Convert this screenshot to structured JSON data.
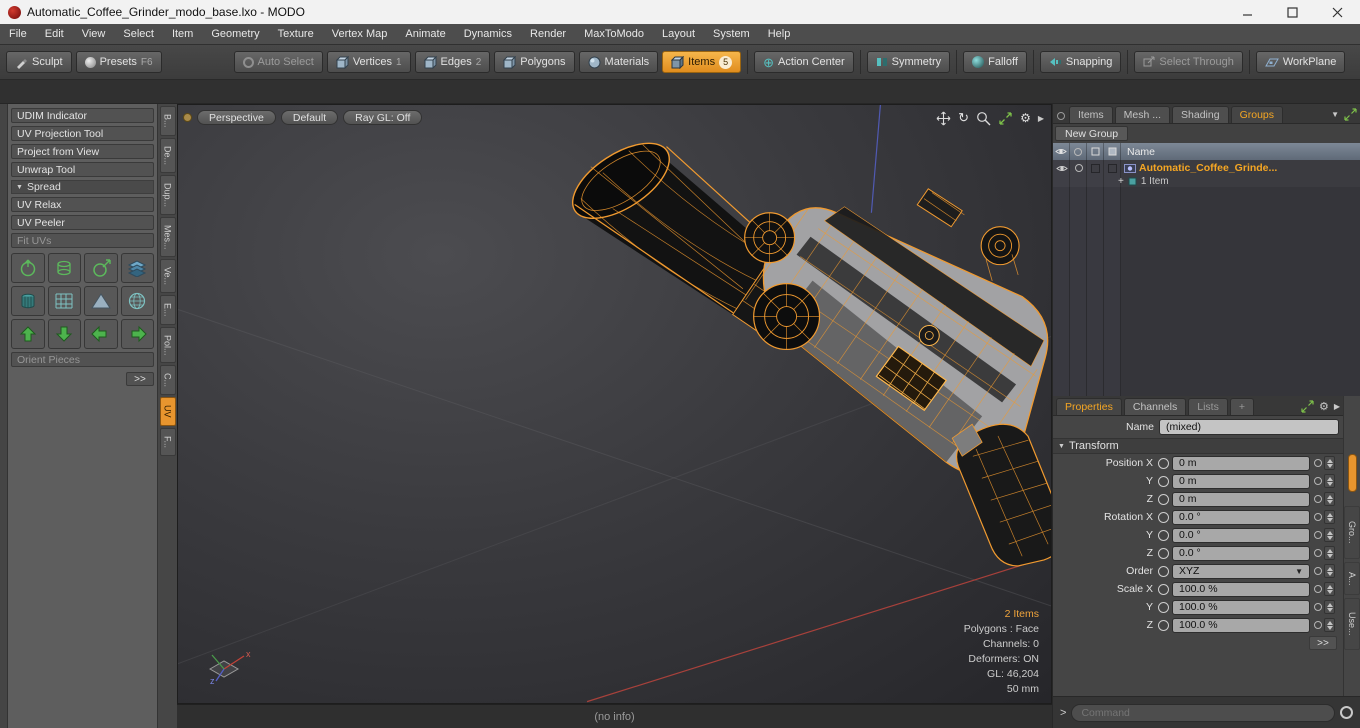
{
  "window": {
    "title": "Automatic_Coffee_Grinder_modo_base.lxo - MODO"
  },
  "menu": {
    "items": [
      "File",
      "Edit",
      "View",
      "Select",
      "Item",
      "Geometry",
      "Texture",
      "Vertex Map",
      "Animate",
      "Dynamics",
      "Render",
      "MaxToModo",
      "Layout",
      "System",
      "Help"
    ]
  },
  "toolbar": {
    "sculpt": "Sculpt",
    "presets": "Presets",
    "presets_key": "F6",
    "auto_select": "Auto Select",
    "vertices": "Vertices",
    "vertices_key": "1",
    "edges": "Edges",
    "edges_key": "2",
    "polygons": "Polygons",
    "materials": "Materials",
    "items": "Items",
    "items_badge": "5",
    "action_center": "Action Center",
    "symmetry": "Symmetry",
    "falloff": "Falloff",
    "snapping": "Snapping",
    "select_through": "Select Through",
    "workplane": "WorkPlane"
  },
  "left_panel": {
    "tools": [
      "UDIM Indicator",
      "UV Projection Tool",
      "Project from View",
      "Unwrap Tool"
    ],
    "spread_header": "Spread",
    "uv_relax": "UV Relax",
    "uv_peeler": "UV Peeler",
    "fit_uvs": "Fit UVs",
    "orient_pieces": "Orient Pieces",
    "more": ">>",
    "tabs": [
      "B...",
      "De...",
      "Dup...",
      "Mes...",
      "Ve...",
      "E...",
      "Pol...",
      "C...",
      "UV",
      "F..."
    ],
    "active_tab": "UV"
  },
  "viewport": {
    "view_mode": "Perspective",
    "shading": "Default",
    "raygl": "Ray GL: Off",
    "stats": [
      "2 Items",
      "Polygons : Face",
      "Channels: 0",
      "Deformers: ON",
      "GL: 46,204",
      "50 mm"
    ],
    "info": "(no info)",
    "gizmo_x": "x",
    "gizmo_z": "z"
  },
  "items_panel": {
    "tabs": [
      "Items",
      "Mesh ...",
      "Shading",
      "Groups"
    ],
    "active_tab": "Groups",
    "new_group": "New Group",
    "name_header": "Name",
    "row_name": "Automatic_Coffee_Grinde...",
    "row_sub": "1 Item",
    "row_expand": "+"
  },
  "properties": {
    "tabs": [
      "Properties",
      "Channels",
      "Lists",
      "+"
    ],
    "active_tab": "Properties",
    "name_label": "Name",
    "name_value": "(mixed)",
    "transform": "Transform",
    "rows": [
      {
        "label": "Position X",
        "value": "0 m"
      },
      {
        "label": "Y",
        "value": "0 m"
      },
      {
        "label": "Z",
        "value": "0 m"
      },
      {
        "label": "Rotation X",
        "value": "0.0 °"
      },
      {
        "label": "Y",
        "value": "0.0 °"
      },
      {
        "label": "Z",
        "value": "0.0 °"
      },
      {
        "label": "Order",
        "value": "XYZ"
      },
      {
        "label": "Scale X",
        "value": "100.0 %"
      },
      {
        "label": "Y",
        "value": "100.0 %"
      },
      {
        "label": "Z",
        "value": "100.0 %"
      }
    ],
    "more": ">>",
    "side_tabs": [
      "Gro...",
      "A...",
      "Use..."
    ]
  },
  "command": {
    "prompt": ">",
    "placeholder": "Command"
  },
  "icons": {
    "gear": "⚙",
    "triangle_down": "▼",
    "triangle_right": "▶",
    "rotate": "↻",
    "action_center": "⊕"
  },
  "colors": {
    "accent_orange": "#e8952e",
    "wireframe_orange": "#f09a30",
    "teal": "#56c0c0"
  }
}
